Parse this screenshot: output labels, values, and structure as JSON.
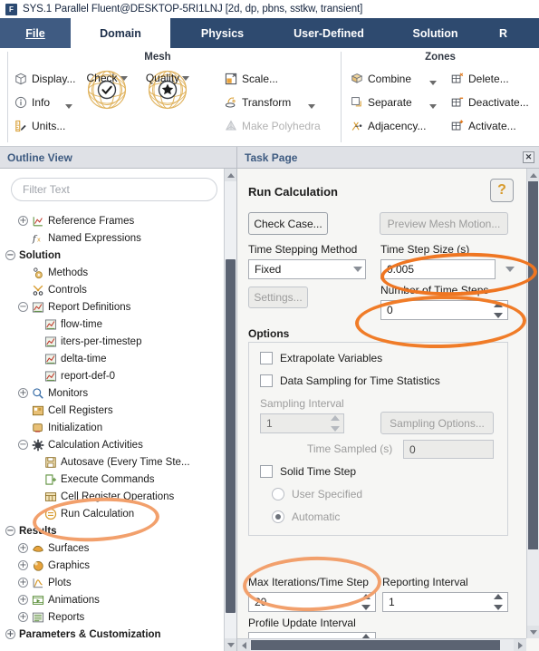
{
  "window": {
    "logo_letter": "F",
    "title": "SYS.1 Parallel Fluent@DESKTOP-5RI1LNJ  [2d, dp, pbns, sstkw, transient]"
  },
  "ribbon": {
    "tabs": [
      {
        "label": "File",
        "active": false
      },
      {
        "label": "Domain",
        "active": true
      },
      {
        "label": "Physics",
        "active": false
      },
      {
        "label": "User-Defined",
        "active": false
      },
      {
        "label": "Solution",
        "active": false
      },
      {
        "label": "R",
        "active": false
      }
    ],
    "groups": [
      {
        "title": "Mesh"
      },
      {
        "title": "Zones"
      }
    ],
    "mesh": {
      "display": "Display...",
      "info": "Info",
      "units": "Units...",
      "check": "Check",
      "quality": "Quality",
      "scale": "Scale...",
      "transform": "Transform",
      "make_polyhedra": "Make Polyhedra"
    },
    "zones": {
      "combine": "Combine",
      "separate": "Separate",
      "adjacency": "Adjacency...",
      "delete": "Delete...",
      "deactivate": "Deactivate...",
      "activate": "Activate..."
    }
  },
  "outline": {
    "header": "Outline View",
    "filter_placeholder": "Filter Text",
    "tree": [
      {
        "label": "Reference Frames",
        "indent": 1,
        "expander": "+",
        "icon": "axes-icon",
        "bold": false
      },
      {
        "label": "Named Expressions",
        "indent": 1,
        "expander": "",
        "icon": "fx-icon",
        "bold": false
      },
      {
        "label": "Solution",
        "indent": 0,
        "expander": "−",
        "icon": "",
        "bold": true
      },
      {
        "label": "Methods",
        "indent": 1,
        "expander": "",
        "icon": "methods-icon",
        "bold": false
      },
      {
        "label": "Controls",
        "indent": 1,
        "expander": "",
        "icon": "controls-icon",
        "bold": false
      },
      {
        "label": "Report Definitions",
        "indent": 1,
        "expander": "−",
        "icon": "report-icon",
        "bold": false
      },
      {
        "label": "flow-time",
        "indent": 2,
        "expander": "",
        "icon": "report-icon",
        "bold": false
      },
      {
        "label": "iters-per-timestep",
        "indent": 2,
        "expander": "",
        "icon": "report-icon",
        "bold": false
      },
      {
        "label": "delta-time",
        "indent": 2,
        "expander": "",
        "icon": "report-icon",
        "bold": false
      },
      {
        "label": "report-def-0",
        "indent": 2,
        "expander": "",
        "icon": "report-icon",
        "bold": false
      },
      {
        "label": "Monitors",
        "indent": 1,
        "expander": "+",
        "icon": "monitors-icon",
        "bold": false
      },
      {
        "label": "Cell Registers",
        "indent": 1,
        "expander": "",
        "icon": "cellreg-icon",
        "bold": false
      },
      {
        "label": "Initialization",
        "indent": 1,
        "expander": "",
        "icon": "init-icon",
        "bold": false
      },
      {
        "label": "Calculation Activities",
        "indent": 1,
        "expander": "−",
        "icon": "gear-icon",
        "bold": false
      },
      {
        "label": "Autosave (Every Time Ste...",
        "indent": 2,
        "expander": "",
        "icon": "save-icon",
        "bold": false
      },
      {
        "label": "Execute Commands",
        "indent": 2,
        "expander": "",
        "icon": "exec-icon",
        "bold": false
      },
      {
        "label": "Cell Register Operations",
        "indent": 2,
        "expander": "",
        "icon": "cellop-icon",
        "bold": false
      },
      {
        "label": "Run Calculation",
        "indent": 2,
        "expander": "",
        "icon": "run-icon",
        "bold": false
      },
      {
        "label": "Results",
        "indent": 0,
        "expander": "−",
        "icon": "",
        "bold": true
      },
      {
        "label": "Surfaces",
        "indent": 1,
        "expander": "+",
        "icon": "surfaces-icon",
        "bold": false
      },
      {
        "label": "Graphics",
        "indent": 1,
        "expander": "+",
        "icon": "graphics-icon",
        "bold": false
      },
      {
        "label": "Plots",
        "indent": 1,
        "expander": "+",
        "icon": "plots-icon",
        "bold": false
      },
      {
        "label": "Animations",
        "indent": 1,
        "expander": "+",
        "icon": "animations-icon",
        "bold": false
      },
      {
        "label": "Reports",
        "indent": 1,
        "expander": "+",
        "icon": "reports-icon",
        "bold": false
      },
      {
        "label": "Parameters & Customization",
        "indent": 0,
        "expander": "+",
        "icon": "",
        "bold": true
      }
    ]
  },
  "task_page": {
    "header": "Task Page",
    "close_label": "✕",
    "title": "Run Calculation",
    "help_label": "?",
    "check_case_label": "Check Case...",
    "preview_mesh_motion_label": "Preview Mesh Motion...",
    "time_stepping_method_label": "Time Stepping Method",
    "time_stepping_method_value": "Fixed",
    "settings_label": "Settings...",
    "time_step_size_label": "Time Step Size (s)",
    "time_step_size_value": "0.005",
    "number_of_time_steps_label": "Number of Time Steps",
    "number_of_time_steps_value": "0",
    "options_group_label": "Options",
    "extrapolate_variables_label": "Extrapolate Variables",
    "data_sampling_label": "Data Sampling for Time Statistics",
    "sampling_interval_label": "Sampling Interval",
    "sampling_interval_value": "1",
    "sampling_options_label": "Sampling Options...",
    "time_sampled_label": "Time Sampled (s)",
    "time_sampled_value": "0",
    "solid_time_step_label": "Solid Time Step",
    "user_specified_label": "User Specified",
    "automatic_label": "Automatic",
    "max_iterations_label": "Max Iterations/Time Step",
    "max_iterations_value": "20",
    "reporting_interval_label": "Reporting Interval",
    "reporting_interval_value": "1",
    "profile_update_interval_label": "Profile Update Interval"
  },
  "annotations": {
    "color_strong": "#ef7622",
    "color_soft": "#f3a06a",
    "items": [
      {
        "name": "time-step-size-highlight"
      },
      {
        "name": "number-of-time-steps-highlight"
      },
      {
        "name": "run-calculation-highlight"
      },
      {
        "name": "max-iterations-highlight"
      }
    ]
  }
}
